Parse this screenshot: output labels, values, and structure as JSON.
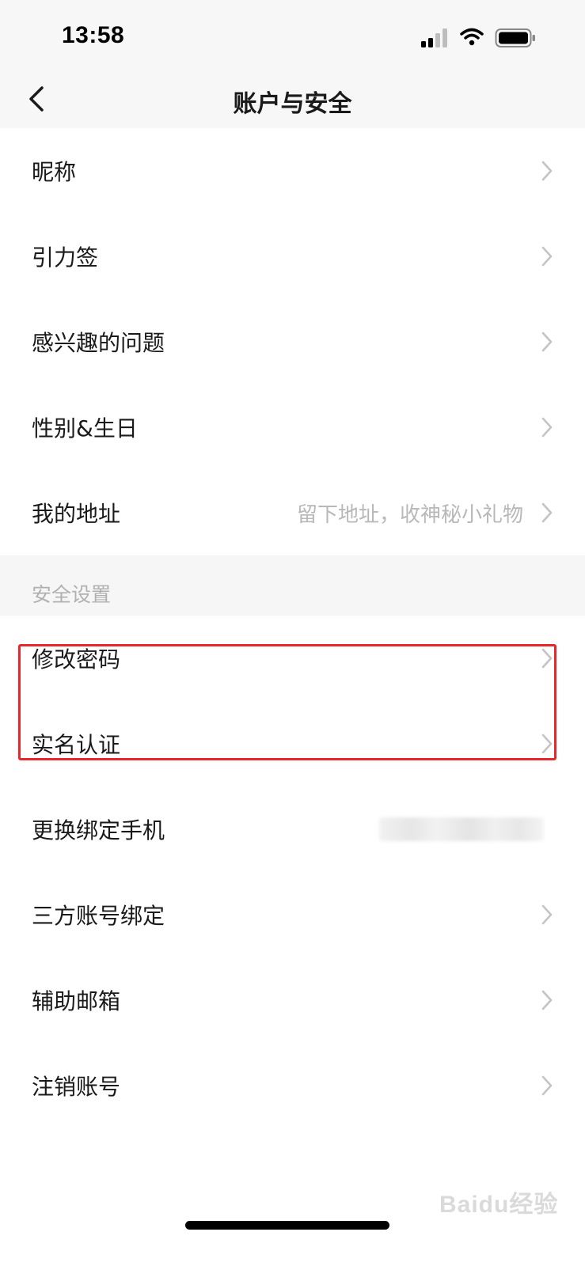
{
  "status_bar": {
    "time": "13:58"
  },
  "nav": {
    "title": "账户与安全"
  },
  "profile_items": [
    {
      "label": "昵称",
      "value": ""
    },
    {
      "label": "引力签",
      "value": ""
    },
    {
      "label": "感兴趣的问题",
      "value": ""
    },
    {
      "label": "性别&生日",
      "value": ""
    },
    {
      "label": "我的地址",
      "value": "留下地址，收神秘小礼物"
    }
  ],
  "security_section": {
    "title": "安全设置"
  },
  "security_items": [
    {
      "label": "修改密码"
    },
    {
      "label": "实名认证"
    },
    {
      "label": "更换绑定手机"
    },
    {
      "label": "三方账号绑定"
    },
    {
      "label": "辅助邮箱"
    },
    {
      "label": "注销账号"
    }
  ],
  "watermark": {
    "text": "Baidu经验"
  },
  "colors": {
    "highlight": "#e8272a",
    "placeholder_text": "#b8b8b8",
    "section_bg": "#f6f6f6"
  }
}
